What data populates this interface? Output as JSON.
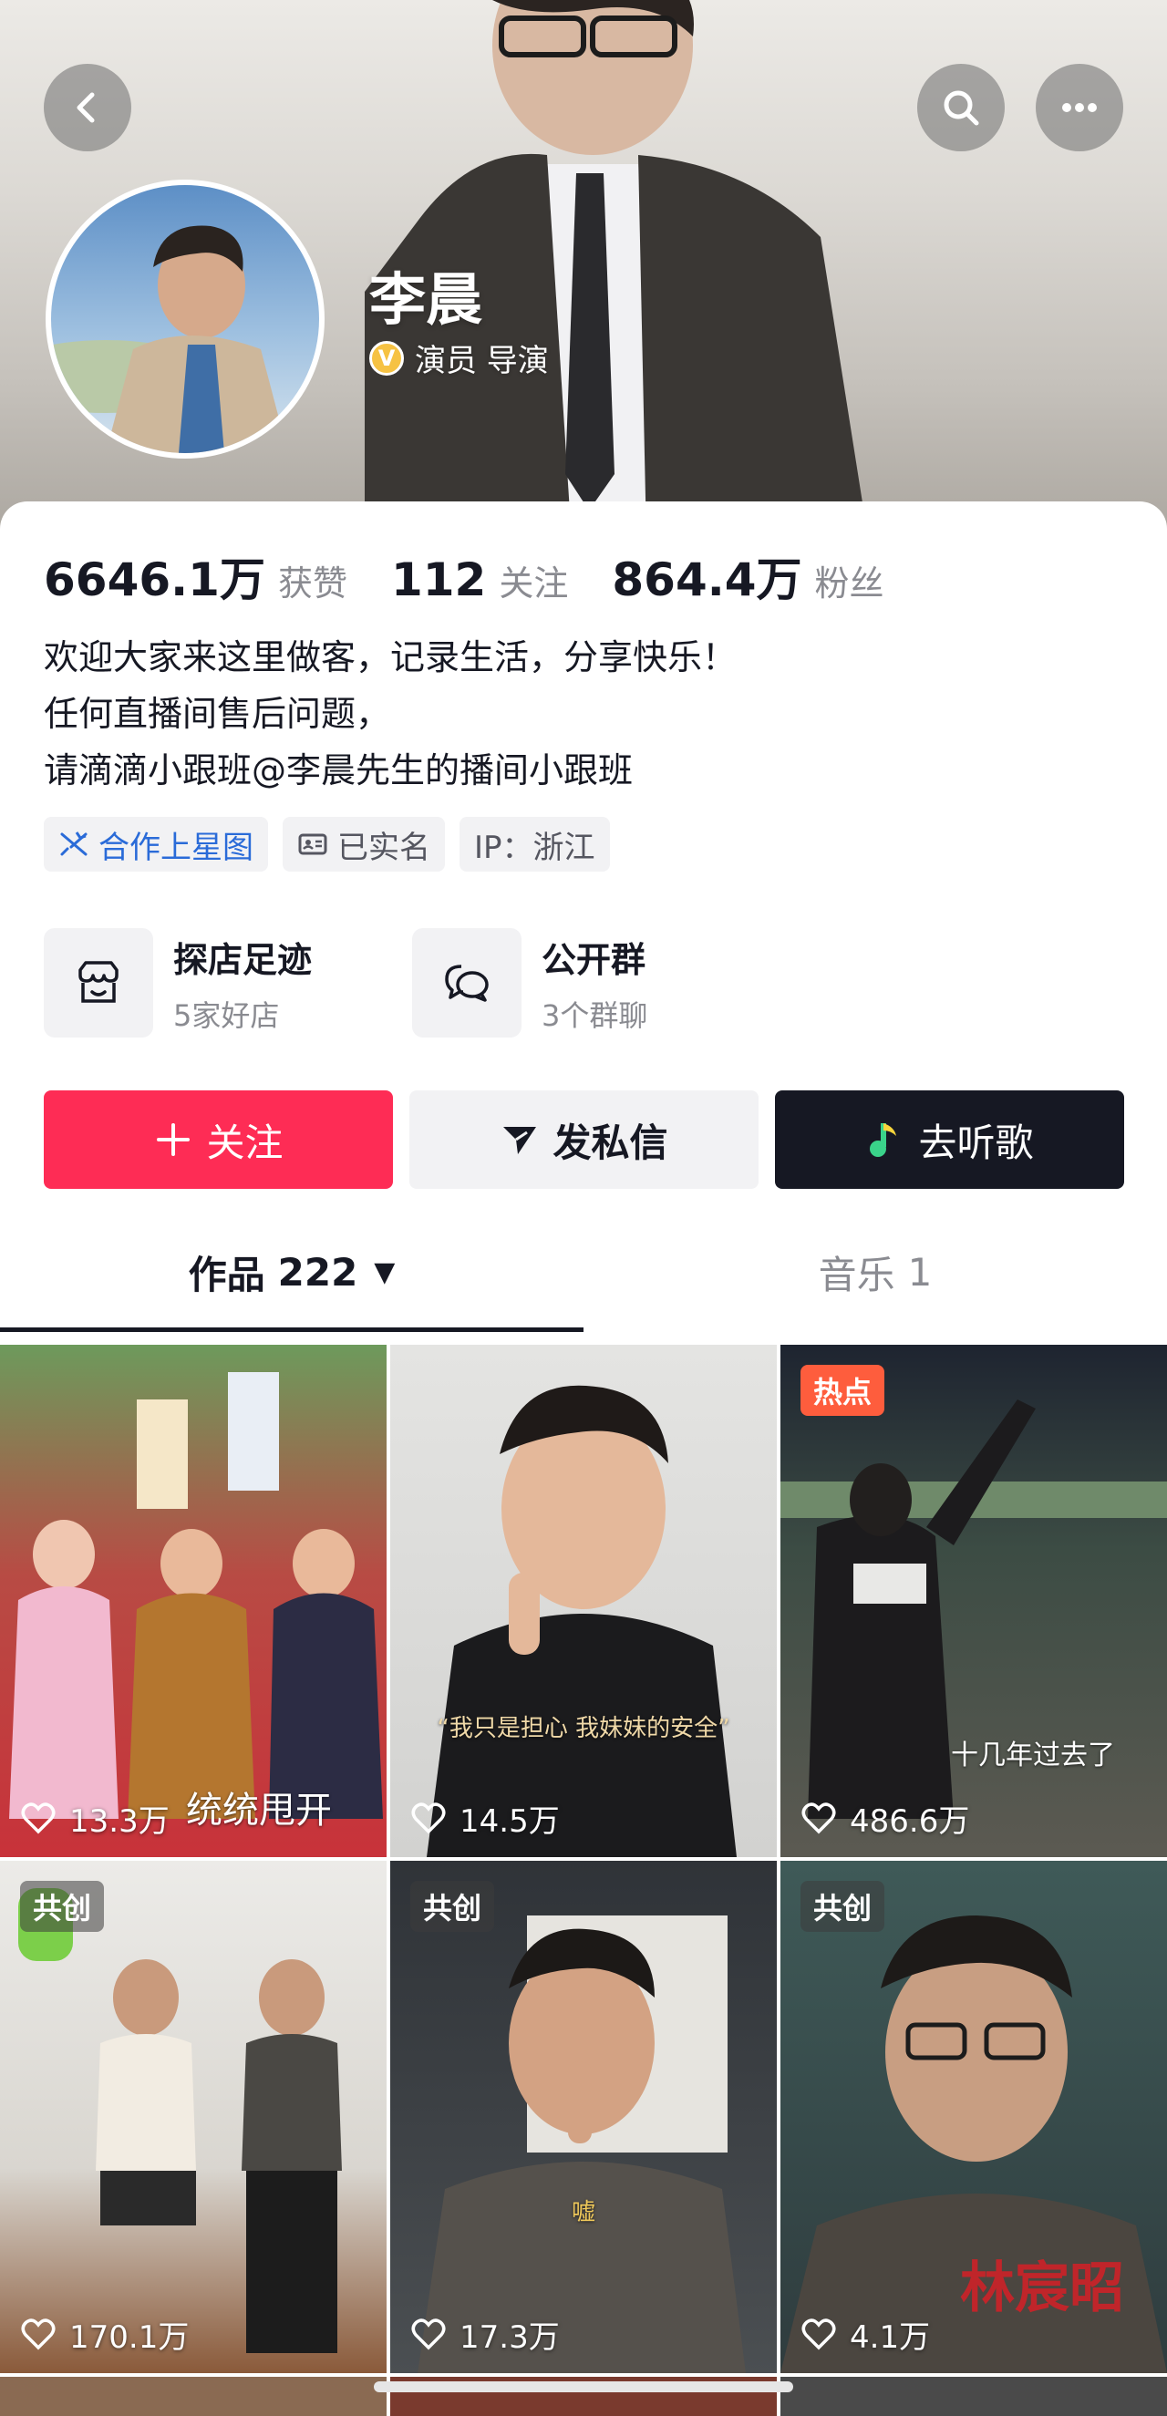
{
  "profile": {
    "name": "李晨",
    "verified_badge": "V",
    "verified_text": "演员 导演"
  },
  "stats": [
    {
      "value": "6646.1万",
      "label": "获赞"
    },
    {
      "value": "112",
      "label": "关注"
    },
    {
      "value": "864.4万",
      "label": "粉丝"
    }
  ],
  "bio": [
    "欢迎大家来这里做客，记录生活，分享快乐！",
    "任何直播间售后问题，",
    "请滴滴小跟班@李晨先生的播间小跟班"
  ],
  "tags": [
    {
      "label": "合作上星图",
      "icon": "star-map-icon"
    },
    {
      "label": "已实名",
      "icon": "id-card-icon"
    },
    {
      "label": "IP：浙江"
    }
  ],
  "shortcuts": [
    {
      "title": "探店足迹",
      "subtitle": "5家好店",
      "icon": "shop-icon"
    },
    {
      "title": "公开群",
      "subtitle": "3个群聊",
      "icon": "chat-bubbles-icon"
    }
  ],
  "actions": {
    "follow": "关注",
    "message": "发私信",
    "music": "去听歌"
  },
  "tabs": {
    "works_label": "作品",
    "works_count": "222",
    "music_label": "音乐",
    "music_count": "1"
  },
  "videos": [
    {
      "likes": "13.3万",
      "caption": "统统甩开",
      "badge": ""
    },
    {
      "likes": "14.5万",
      "caption": "“我只是担心 我妹妹的安全”",
      "badge": ""
    },
    {
      "likes": "486.6万",
      "caption": "十几年过去了",
      "badge": "热点"
    },
    {
      "likes": "170.1万",
      "caption": "",
      "badge": "共创"
    },
    {
      "likes": "17.3万",
      "caption": "嘘",
      "badge": "共创"
    },
    {
      "likes": "4.1万",
      "caption": "林宸昭",
      "badge": "共创"
    }
  ],
  "colors": {
    "accent": "#fe2c55",
    "dark_button": "#161823",
    "hot_badge": "#fe5d3d",
    "verify_gold": "#f6c243",
    "link_blue": "#2a6bd8"
  }
}
